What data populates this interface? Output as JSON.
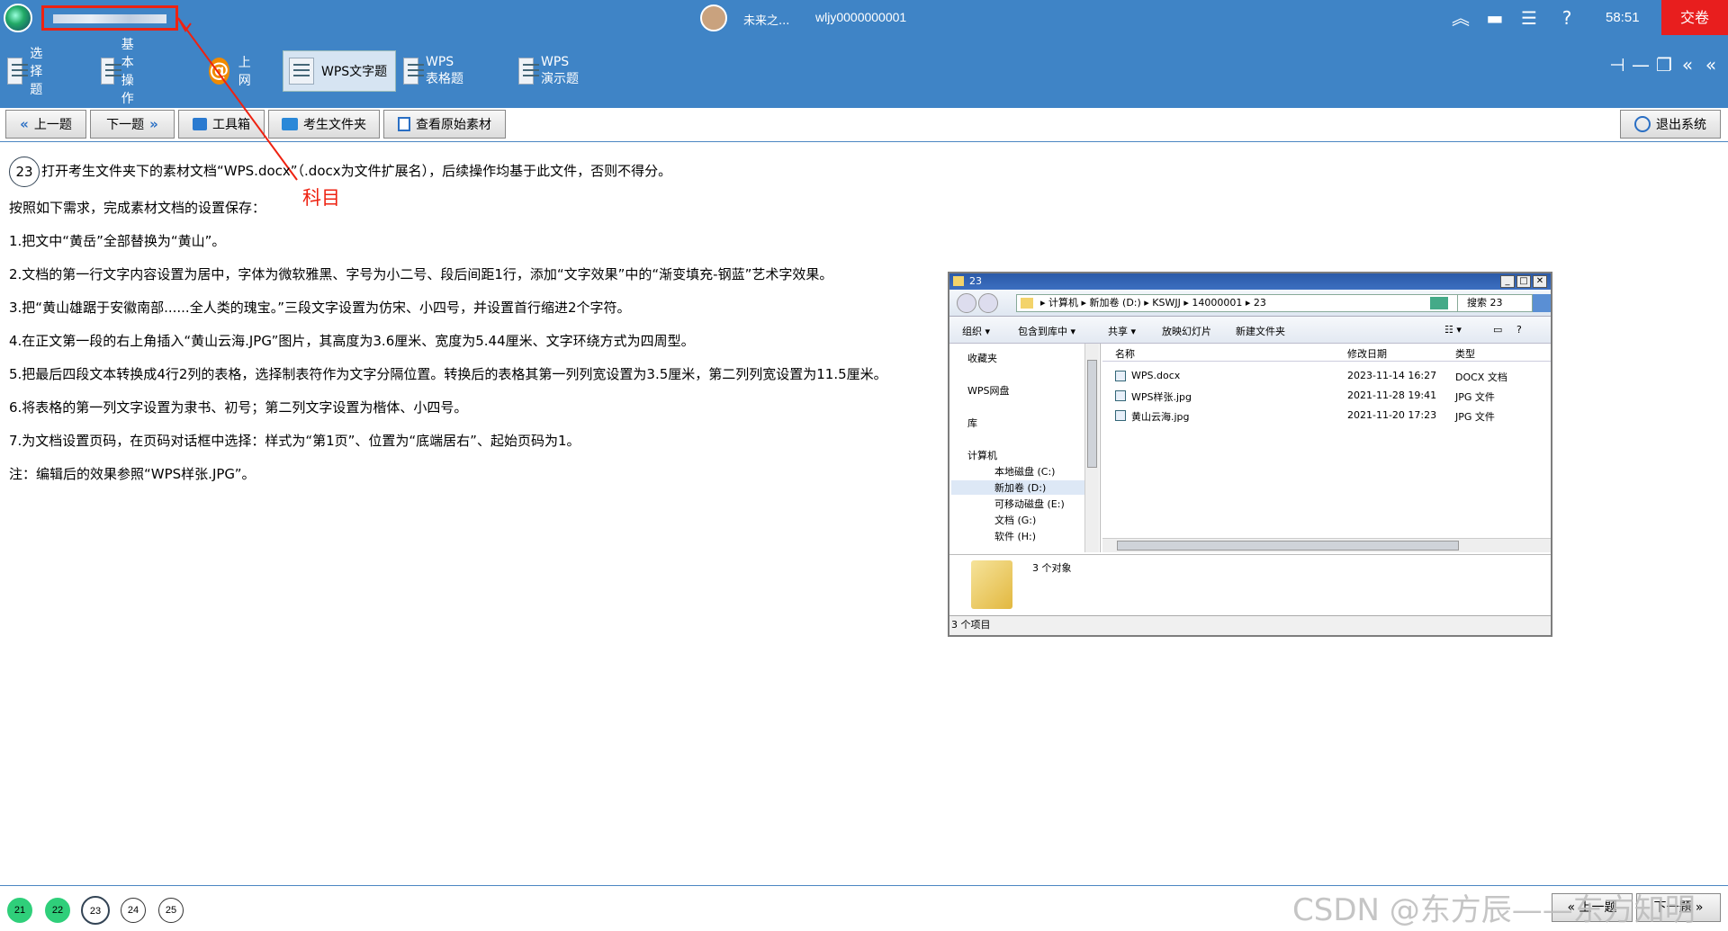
{
  "header": {
    "username": "未来之...",
    "user_id": "wljy0000000001",
    "timer": "58:51",
    "submit_label": "交卷"
  },
  "tabs": [
    {
      "label": "选择题",
      "icon": "list-icon"
    },
    {
      "label": "基本操作",
      "icon": "grid-icon"
    },
    {
      "label": "上网",
      "icon": "at-icon"
    },
    {
      "label": "WPS文字题",
      "icon": "doc-icon",
      "active": true
    },
    {
      "label": "WPS表格题",
      "icon": "table-icon"
    },
    {
      "label": "WPS演示题",
      "icon": "slide-icon"
    }
  ],
  "toolbar": {
    "prev_label": "上一题",
    "next_label": "下一题",
    "toolbox_label": "工具箱",
    "folder_label": "考生文件夹",
    "material_label": "查看原始素材",
    "exit_label": "退出系统"
  },
  "annotation": {
    "label": "科目"
  },
  "question": {
    "number": "23",
    "lines": [
      "打开考生文件夹下的素材文档“WPS.docx”（.docx为文件扩展名），后续操作均基于此文件，否则不得分。",
      "按照如下需求，完成素材文档的设置保存：",
      "1.把文中“黄岳”全部替换为“黄山”。",
      "2.文档的第一行文字内容设置为居中，字体为微软雅黑、字号为小二号、段后间距1行，添加“文字效果”中的“渐变填充-钢蓝”艺术字效果。",
      "3.把“黄山雄踞于安徽南部......全人类的瑰宝。”三段文字设置为仿宋、小四号，并设置首行缩进2个字符。",
      "4.在正文第一段的右上角插入“黄山云海.JPG”图片，其高度为3.6厘米、宽度为5.44厘米、文字环绕方式为四周型。",
      "5.把最后四段文本转换成4行2列的表格，选择制表符作为文字分隔位置。转换后的表格其第一列列宽设置为3.5厘米，第二列列宽设置为11.5厘米。",
      "6.将表格的第一列文字设置为隶书、初号；第二列文字设置为楷体、小四号。",
      "7.为文档设置页码，在页码对话框中选择：样式为“第1页”、位置为“底端居右”、起始页码为1。",
      "注：编辑后的效果参照“WPS样张.JPG”。"
    ]
  },
  "explorer": {
    "title": "23",
    "path": "▸ 计算机 ▸ 新加卷 (D:) ▸ KSWJJ ▸ 14000001 ▸ 23",
    "search_placeholder": "搜索 23",
    "commands": [
      "组织 ▾",
      "包含到库中 ▾",
      "共享 ▾",
      "放映幻灯片",
      "新建文件夹"
    ],
    "nav_items": [
      "收藏夹",
      "WPS网盘",
      "库",
      "计算机",
      "本地磁盘 (C:)",
      "新加卷 (D:)",
      "可移动磁盘 (E:)",
      "文档 (G:)",
      "软件 (H:)"
    ],
    "columns": [
      "名称",
      "修改日期",
      "类型"
    ],
    "files": [
      {
        "name": "WPS.docx",
        "date": "2023-11-14 16:27",
        "type": "DOCX 文档"
      },
      {
        "name": "WPS样张.jpg",
        "date": "2021-11-28 19:41",
        "type": "JPG 文件"
      },
      {
        "name": "黄山云海.jpg",
        "date": "2021-11-20 17:23",
        "type": "JPG 文件"
      }
    ],
    "detail_count": "3 个对象",
    "status": "3 个项目"
  },
  "footer": {
    "questions": [
      {
        "n": "21",
        "state": "done"
      },
      {
        "n": "22",
        "state": "done"
      },
      {
        "n": "23",
        "state": "current"
      },
      {
        "n": "24",
        "state": "todo"
      },
      {
        "n": "25",
        "state": "todo"
      }
    ],
    "prev_label": "上一题",
    "next_label": "下一题",
    "watermark": "CSDN @东方辰——东方知明"
  },
  "colors": {
    "header_bg": "#3f84c6",
    "submit_bg": "#e81e1e",
    "annotation": "#e21",
    "done": "#2fcf7a"
  }
}
